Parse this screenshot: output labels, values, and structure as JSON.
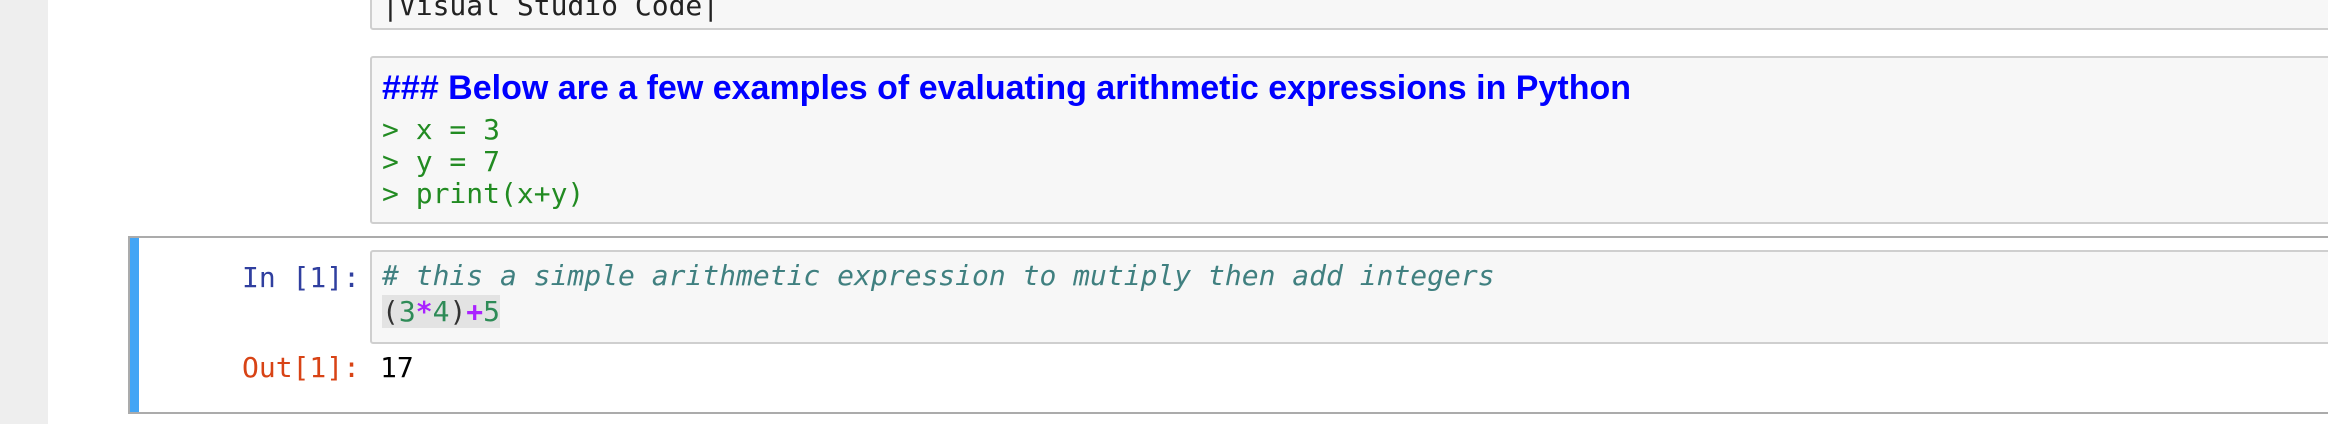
{
  "top_cell": {
    "text": "|Visual Studio Code|"
  },
  "markdown_cell": {
    "heading": "### Below are a few examples of evaluating arithmetic expressions in Python",
    "lines": [
      "> x = 3",
      "> y = 7",
      "> print(x+y)"
    ]
  },
  "code_cell": {
    "in_prompt": "In [1]:",
    "comment": "# this a simple arithmetic expression to mutiply then add integers",
    "expression_tokens": [
      "(",
      "3",
      "*",
      "4",
      ")",
      "+",
      "5"
    ],
    "out_prompt": "Out[1]:",
    "output": "17"
  },
  "colors": {
    "heading": "#0000ff",
    "quote": "#228b22",
    "comment": "#408080",
    "in_prompt": "#303f9f",
    "out_prompt": "#d84315",
    "selected_stripe": "#42a5f5",
    "operator": "#aa22ff",
    "number": "#2e8b57"
  }
}
